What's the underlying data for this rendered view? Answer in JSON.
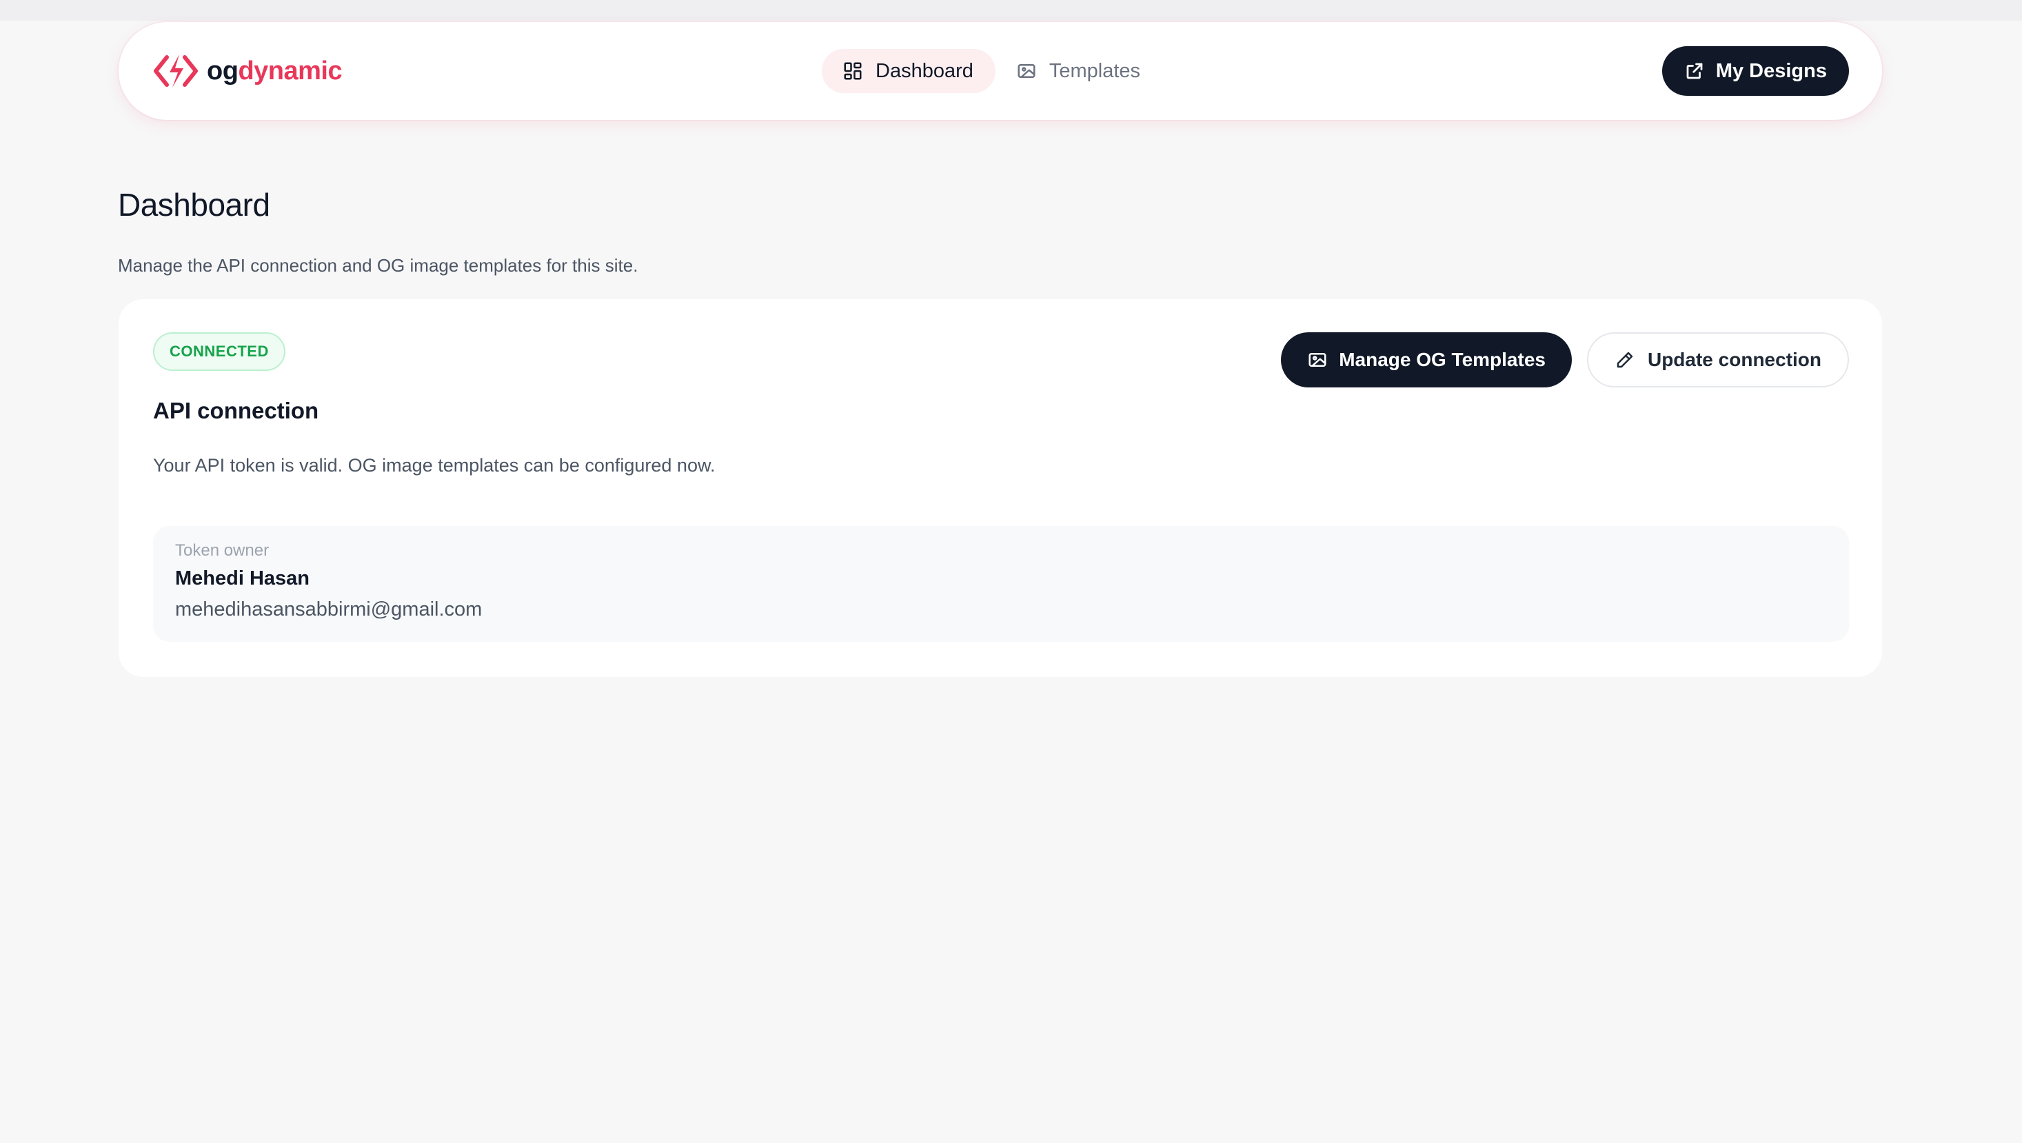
{
  "brand": {
    "name_part1": "og",
    "name_part2": "dynamic",
    "accent_color": "#e8385a",
    "icon": "bolt-code-icon"
  },
  "nav": {
    "items": [
      {
        "label": "Dashboard",
        "icon": "grid-icon",
        "active": true
      },
      {
        "label": "Templates",
        "icon": "image-icon",
        "active": false
      }
    ],
    "cta_label": "My Designs",
    "cta_icon": "external-link-icon"
  },
  "page": {
    "title": "Dashboard",
    "subtitle": "Manage the API connection and OG image templates for this site."
  },
  "connection": {
    "status": "CONNECTED",
    "status_color": "#16a34a",
    "title": "API connection",
    "description": "Your API token is valid. OG image templates can be configured now.",
    "manage_label": "Manage OG Templates",
    "update_label": "Update connection",
    "owner_label": "Token owner",
    "owner_name": "Mehedi Hasan",
    "owner_email": "mehedihasansabbirmi@gmail.com"
  }
}
